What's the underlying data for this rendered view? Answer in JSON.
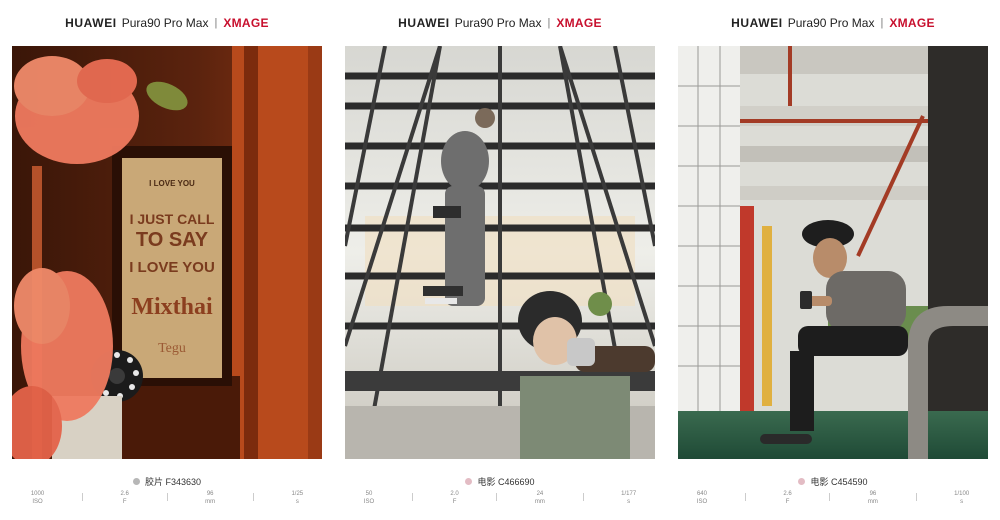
{
  "cards": [
    {
      "brand": "HUAWEI",
      "model": "Pura90 Pro Max",
      "separator": "|",
      "logo": "XMAGE",
      "style_label": "胶片 F343630",
      "dot_color": "#b7b7b7",
      "specs": [
        {
          "value": "1000",
          "unit": "ISO"
        },
        {
          "value": "2.6",
          "unit": "F"
        },
        {
          "value": "96",
          "unit": "mm"
        },
        {
          "value": "1/25",
          "unit": "s"
        }
      ],
      "photo": {
        "sign_lines": [
          "I LOVE YOU",
          "I JUST CALL",
          "TO SAY",
          "I LOVE YOU",
          "Mixthai",
          "Tegu"
        ]
      }
    },
    {
      "brand": "HUAWEI",
      "model": "Pura90 Pro Max",
      "separator": "|",
      "logo": "XMAGE",
      "style_label": "电影 C466690",
      "dot_color": "#e3bcc4",
      "specs": [
        {
          "value": "50",
          "unit": "ISO"
        },
        {
          "value": "2.0",
          "unit": "F"
        },
        {
          "value": "24",
          "unit": "mm"
        },
        {
          "value": "1/177",
          "unit": "s"
        }
      ],
      "photo": {}
    },
    {
      "brand": "HUAWEI",
      "model": "Pura90 Pro Max",
      "separator": "|",
      "logo": "XMAGE",
      "style_label": "电影 C454590",
      "dot_color": "#e3bcc4",
      "specs": [
        {
          "value": "640",
          "unit": "ISO"
        },
        {
          "value": "2.6",
          "unit": "F"
        },
        {
          "value": "96",
          "unit": "mm"
        },
        {
          "value": "1/100",
          "unit": "s"
        }
      ],
      "photo": {}
    }
  ],
  "colors": {
    "xmage_red": "#c8102e"
  }
}
